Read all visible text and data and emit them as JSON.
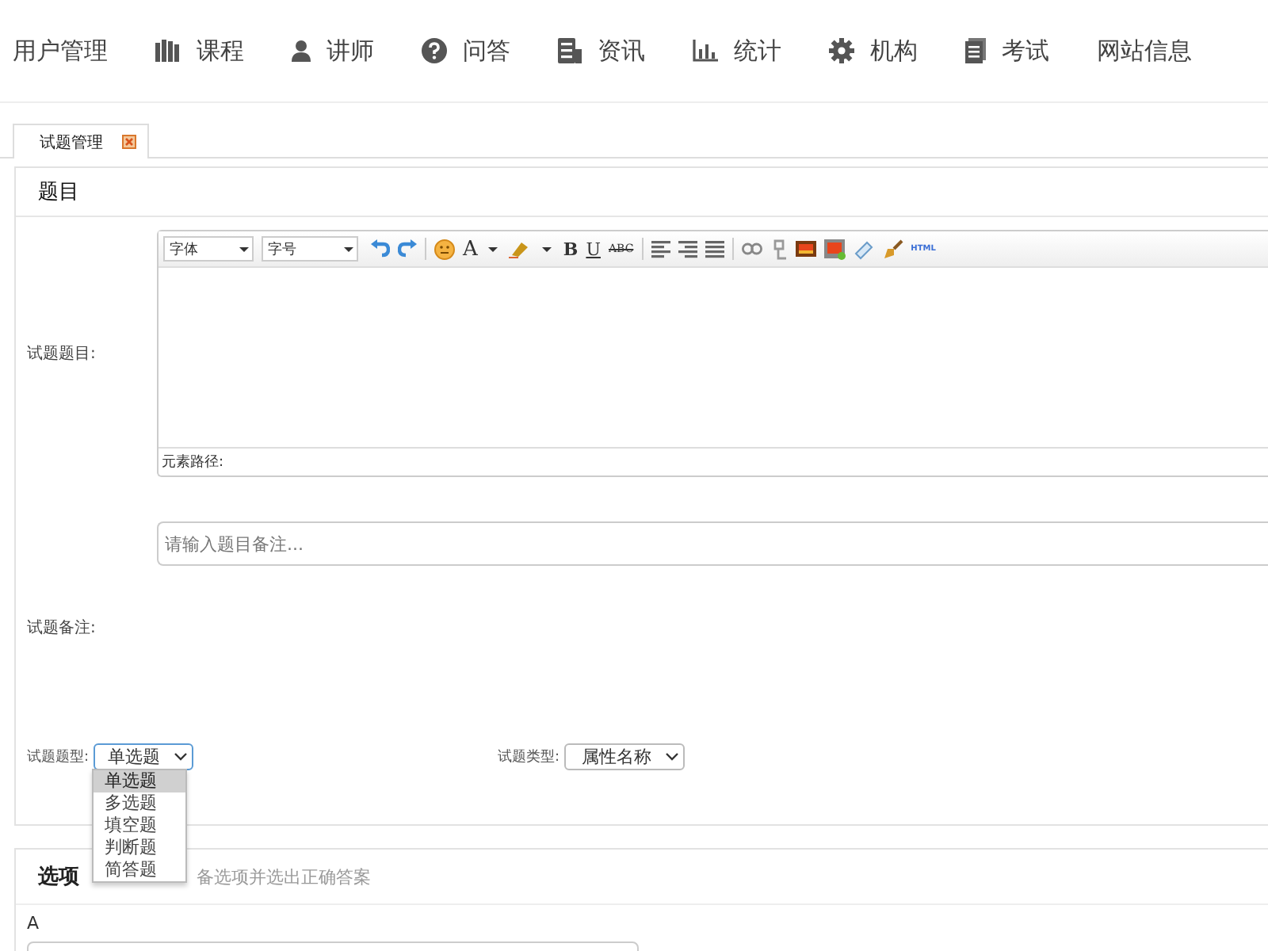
{
  "nav": [
    {
      "label": "用户管理"
    },
    {
      "label": "课程"
    },
    {
      "label": "讲师"
    },
    {
      "label": "问答"
    },
    {
      "label": "资讯"
    },
    {
      "label": "统计"
    },
    {
      "label": "机构"
    },
    {
      "label": "考试"
    },
    {
      "label": "网站信息"
    }
  ],
  "tabs": [
    {
      "label": "试题管理",
      "selected": true
    }
  ],
  "question_panel": {
    "title": "题目",
    "editor": {
      "label": "试题题目:",
      "font": "字体",
      "size": "字号",
      "font_color": "A",
      "bold": "B",
      "underline": "U",
      "strike": "ABC",
      "html": "HTML",
      "path_label": "元素路径:"
    },
    "remark": {
      "label": "试题备注:",
      "placeholder": "请输入题目备注..."
    },
    "type_select": {
      "label": "试题题型:",
      "value": "单选题",
      "expanded": true,
      "options": [
        {
          "label": "单选题",
          "selected": true
        },
        {
          "label": "多选题",
          "selected": false
        },
        {
          "label": "填空题",
          "selected": false
        },
        {
          "label": "判断题",
          "selected": false
        },
        {
          "label": "简答题",
          "selected": false
        }
      ]
    },
    "category_select": {
      "label": "试题类型:",
      "value": "属性名称"
    }
  },
  "options_panel": {
    "title": "选项",
    "hint": "备选项并选出正确答案",
    "first_option": "A"
  }
}
